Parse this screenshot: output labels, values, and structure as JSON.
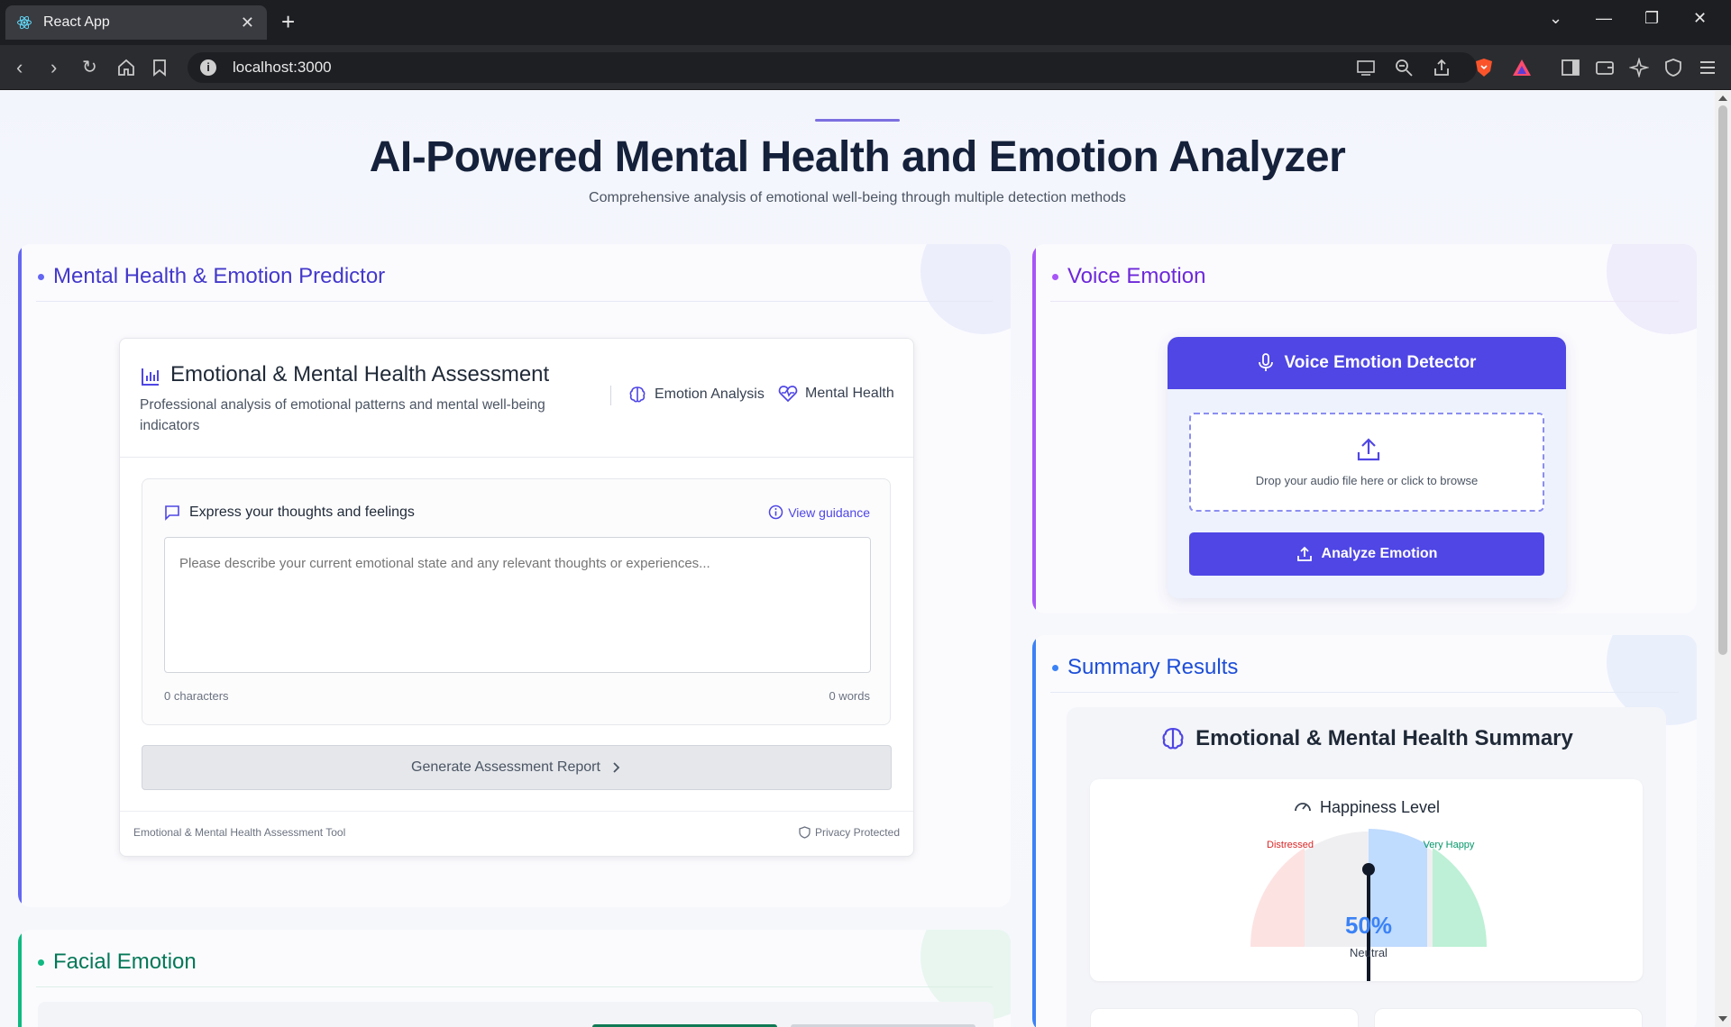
{
  "browser": {
    "tab_title": "React App",
    "url": "localhost:3000"
  },
  "page": {
    "title": "AI-Powered Mental Health and Emotion Analyzer",
    "subtitle": "Comprehensive analysis of emotional well-being through multiple detection methods"
  },
  "predictor": {
    "panel_title": "Mental Health & Emotion Predictor",
    "card_title": "Emotional & Mental Health Assessment",
    "card_desc": "Professional analysis of emotional patterns and mental well-being indicators",
    "badge_emotion": "Emotion Analysis",
    "badge_mental": "Mental Health",
    "input_label": "Express your thoughts and feelings",
    "guidance_link": "View guidance",
    "textarea_placeholder": "Please describe your current emotional state and any relevant thoughts or experiences...",
    "char_count": "0 characters",
    "word_count": "0 words",
    "generate_button": "Generate Assessment Report",
    "footer_left": "Emotional & Mental Health Assessment Tool",
    "footer_right": "Privacy Protected"
  },
  "facial": {
    "panel_title": "Facial Emotion"
  },
  "voice": {
    "panel_title": "Voice Emotion",
    "detector_title": "Voice Emotion Detector",
    "drop_text": "Drop your audio file here or click to browse",
    "analyze_button": "Analyze Emotion"
  },
  "summary": {
    "panel_title": "Summary Results",
    "card_title": "Emotional & Mental Health Summary",
    "gauge_label": "Happiness Level",
    "gauge_left": "Distressed",
    "gauge_right": "Very Happy",
    "gauge_value_text": "50%",
    "gauge_value": 0.5,
    "gauge_state": "Neutral"
  },
  "colors": {
    "primary": "#4f46e5",
    "predictor_accent": "#6366f1",
    "voice_accent": "#a855f7",
    "summary_accent": "#3b82f6",
    "facial_accent": "#10b981"
  }
}
